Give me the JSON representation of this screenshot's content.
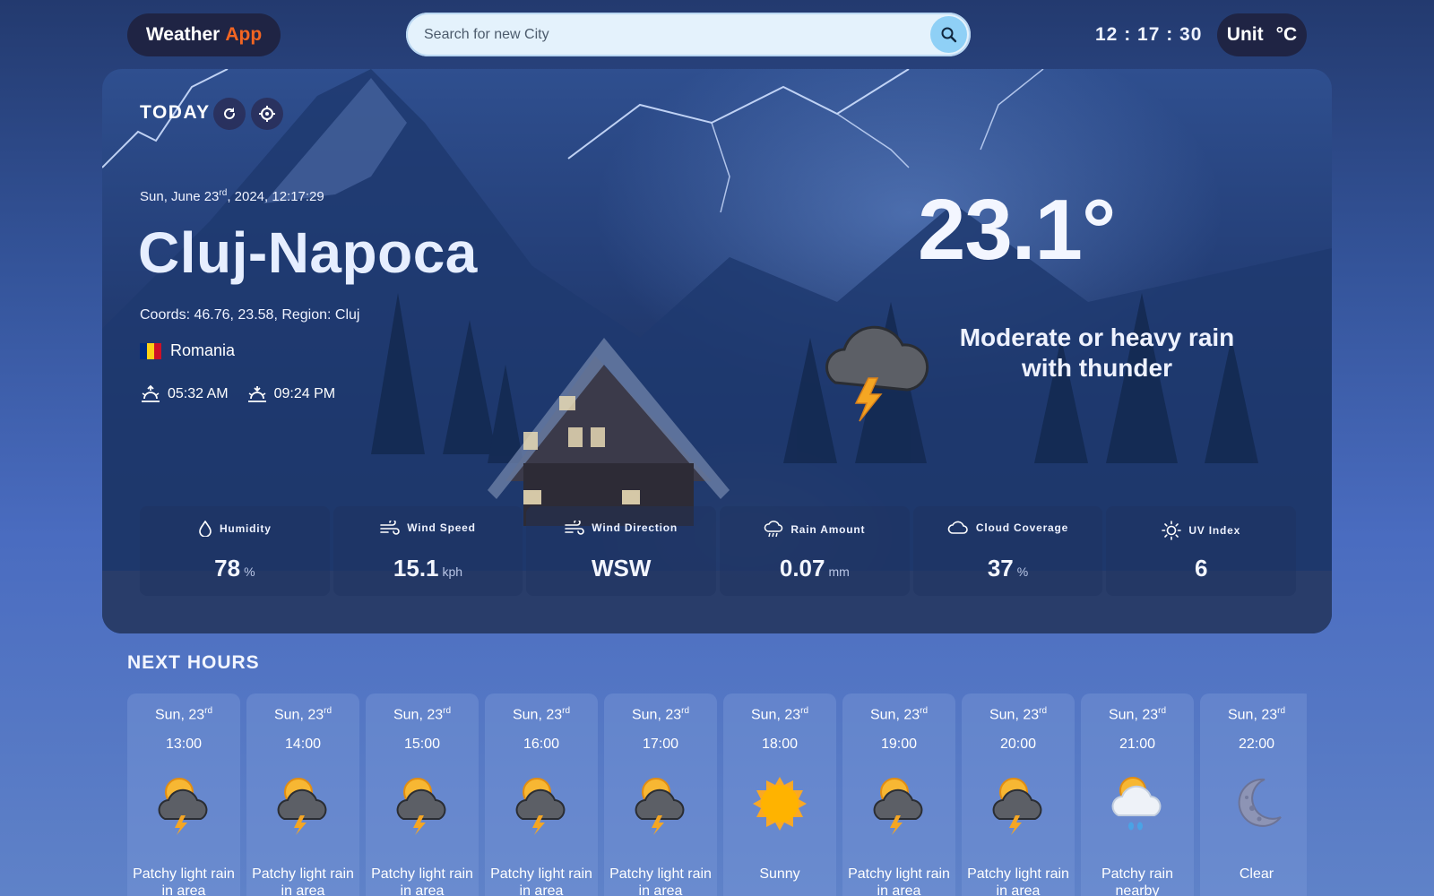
{
  "header": {
    "brand_part1": "Weather",
    "brand_part2": "App",
    "search_placeholder": "Search for new City",
    "clock": "12 : 17 : 30",
    "unit_label": "Unit",
    "unit_value": "°C"
  },
  "today": {
    "label": "TODAY",
    "date_prefix": "Sun, June 23",
    "date_ordinal": "rd",
    "date_suffix": ", 2024, 12:17:29",
    "city": "Cluj-Napoca",
    "coords": "Coords: 46.76, 23.58,  Region: Cluj",
    "country": "Romania",
    "sunrise": "05:32 AM",
    "sunset": "09:24 PM",
    "temperature": "23.1°",
    "condition": "Moderate or heavy rain with thunder"
  },
  "stats": [
    {
      "label": "Humidity",
      "value": "78",
      "unit": "%",
      "icon": "droplet-icon"
    },
    {
      "label": "Wind Speed",
      "value": "15.1",
      "unit": "kph",
      "icon": "wind-icon"
    },
    {
      "label": "Wind Direction",
      "value": "WSW",
      "unit": "",
      "icon": "wind-direction-icon"
    },
    {
      "label": "Rain Amount",
      "value": "0.07",
      "unit": "mm",
      "icon": "rain-cloud-icon"
    },
    {
      "label": "Cloud Coverage",
      "value": "37",
      "unit": "%",
      "icon": "cloud-icon"
    },
    {
      "label": "UV Index",
      "value": "6",
      "unit": "",
      "icon": "sun-icon"
    }
  ],
  "next_hours": {
    "title": "NEXT HOURS",
    "items": [
      {
        "day": "Sun, 23",
        "ord": "rd",
        "time": "13:00",
        "condition": "Patchy light rain in area",
        "icon": "thunder-sun"
      },
      {
        "day": "Sun, 23",
        "ord": "rd",
        "time": "14:00",
        "condition": "Patchy light rain in area",
        "icon": "thunder-sun"
      },
      {
        "day": "Sun, 23",
        "ord": "rd",
        "time": "15:00",
        "condition": "Patchy light rain in area",
        "icon": "thunder-sun"
      },
      {
        "day": "Sun, 23",
        "ord": "rd",
        "time": "16:00",
        "condition": "Patchy light rain in area",
        "icon": "thunder-sun"
      },
      {
        "day": "Sun, 23",
        "ord": "rd",
        "time": "17:00",
        "condition": "Patchy light rain in area",
        "icon": "thunder-sun"
      },
      {
        "day": "Sun, 23",
        "ord": "rd",
        "time": "18:00",
        "condition": "Sunny",
        "icon": "sun"
      },
      {
        "day": "Sun, 23",
        "ord": "rd",
        "time": "19:00",
        "condition": "Patchy light rain in area",
        "icon": "thunder-sun"
      },
      {
        "day": "Sun, 23",
        "ord": "rd",
        "time": "20:00",
        "condition": "Patchy light rain in area",
        "icon": "thunder-sun"
      },
      {
        "day": "Sun, 23",
        "ord": "rd",
        "time": "21:00",
        "condition": "Patchy rain nearby",
        "icon": "rain-sun"
      },
      {
        "day": "Sun, 23",
        "ord": "rd",
        "time": "22:00",
        "condition": "Clear",
        "icon": "moon"
      }
    ]
  },
  "colors": {
    "accent": "#f26522",
    "pill_dark": "#1f2444",
    "search_bg": "#e4f2fc",
    "search_button": "#8fd0f6",
    "flag_blue": "#002b7f",
    "flag_yellow": "#fcd116",
    "flag_red": "#ce1126"
  }
}
